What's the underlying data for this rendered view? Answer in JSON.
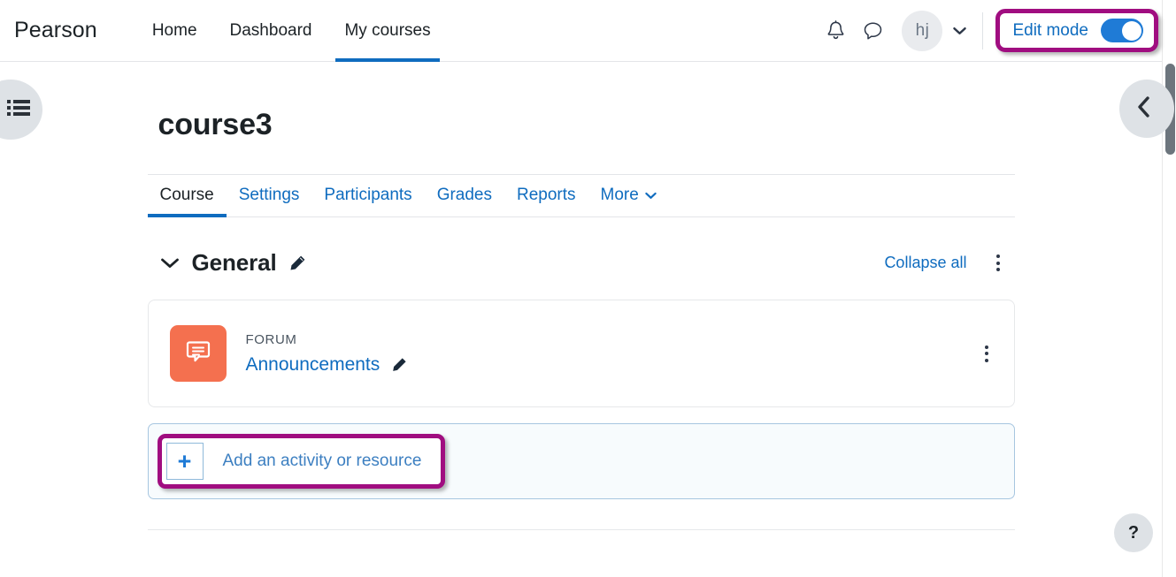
{
  "header": {
    "brand": "Pearson",
    "nav": [
      {
        "label": "Home",
        "active": false
      },
      {
        "label": "Dashboard",
        "active": false
      },
      {
        "label": "My courses",
        "active": true
      }
    ],
    "notifications_icon": "bell-icon",
    "messages_icon": "message-bubble-icon",
    "avatar_initials": "hj",
    "edit_mode_label": "Edit mode",
    "edit_mode_on": true
  },
  "drawers": {
    "left_toggle_icon": "list-menu-icon",
    "right_toggle_icon": "chevron-left-icon"
  },
  "course": {
    "title": "course3",
    "tabs": [
      {
        "label": "Course",
        "active": true,
        "has_caret": false
      },
      {
        "label": "Settings",
        "active": false,
        "has_caret": false
      },
      {
        "label": "Participants",
        "active": false,
        "has_caret": false
      },
      {
        "label": "Grades",
        "active": false,
        "has_caret": false
      },
      {
        "label": "Reports",
        "active": false,
        "has_caret": false
      },
      {
        "label": "More",
        "active": false,
        "has_caret": true
      }
    ]
  },
  "section": {
    "name": "General",
    "expanded": true,
    "edit_icon": "pencil-icon",
    "collapse_all_label": "Collapse all",
    "menu_icon": "kebab-menu-icon"
  },
  "activity": {
    "icon": "forum-speech-bubble-icon",
    "icon_color": "#f4704f",
    "type_label": "FORUM",
    "name": "Announcements",
    "edit_icon": "pencil-icon",
    "menu_icon": "kebab-menu-icon"
  },
  "add_activity": {
    "plus_icon": "plus-icon",
    "label": "Add an activity or resource"
  },
  "help": {
    "label": "?"
  },
  "colors": {
    "highlight": "#a00d80",
    "link": "#0f6cbf",
    "toggle_on": "#1f7bd6",
    "forum_icon": "#f4704f"
  }
}
